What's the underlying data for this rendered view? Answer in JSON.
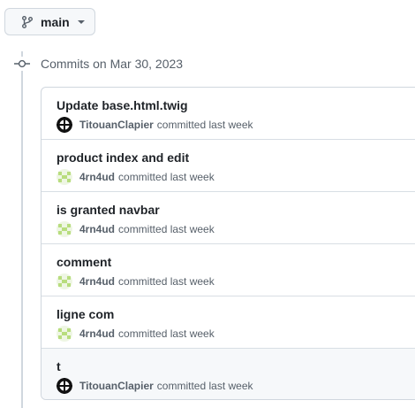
{
  "branch": {
    "name": "main",
    "icon": "git-branch-icon"
  },
  "group": {
    "title": "Commits on Mar 30, 2023",
    "icon": "git-commit-icon"
  },
  "commits": [
    {
      "message": "Update base.html.twig",
      "author": "TitouanClapier",
      "action": "committed last week",
      "avatar": "black-white-avatar"
    },
    {
      "message": "product index and edit",
      "author": "4rn4ud",
      "action": "committed last week",
      "avatar": "green-identicon-avatar"
    },
    {
      "message": "is granted navbar",
      "author": "4rn4ud",
      "action": "committed last week",
      "avatar": "green-identicon-avatar"
    },
    {
      "message": "comment",
      "author": "4rn4ud",
      "action": "committed last week",
      "avatar": "green-identicon-avatar"
    },
    {
      "message": "ligne com",
      "author": "4rn4ud",
      "action": "committed last week",
      "avatar": "green-identicon-avatar"
    },
    {
      "message": "t",
      "author": "TitouanClapier",
      "action": "committed last week",
      "avatar": "black-white-avatar"
    }
  ],
  "colors": {
    "border": "#d0d7de",
    "muted": "#57606a",
    "text": "#1f2328",
    "identicon": "#b8dd7e",
    "hover_row": "#f6f8fa"
  }
}
